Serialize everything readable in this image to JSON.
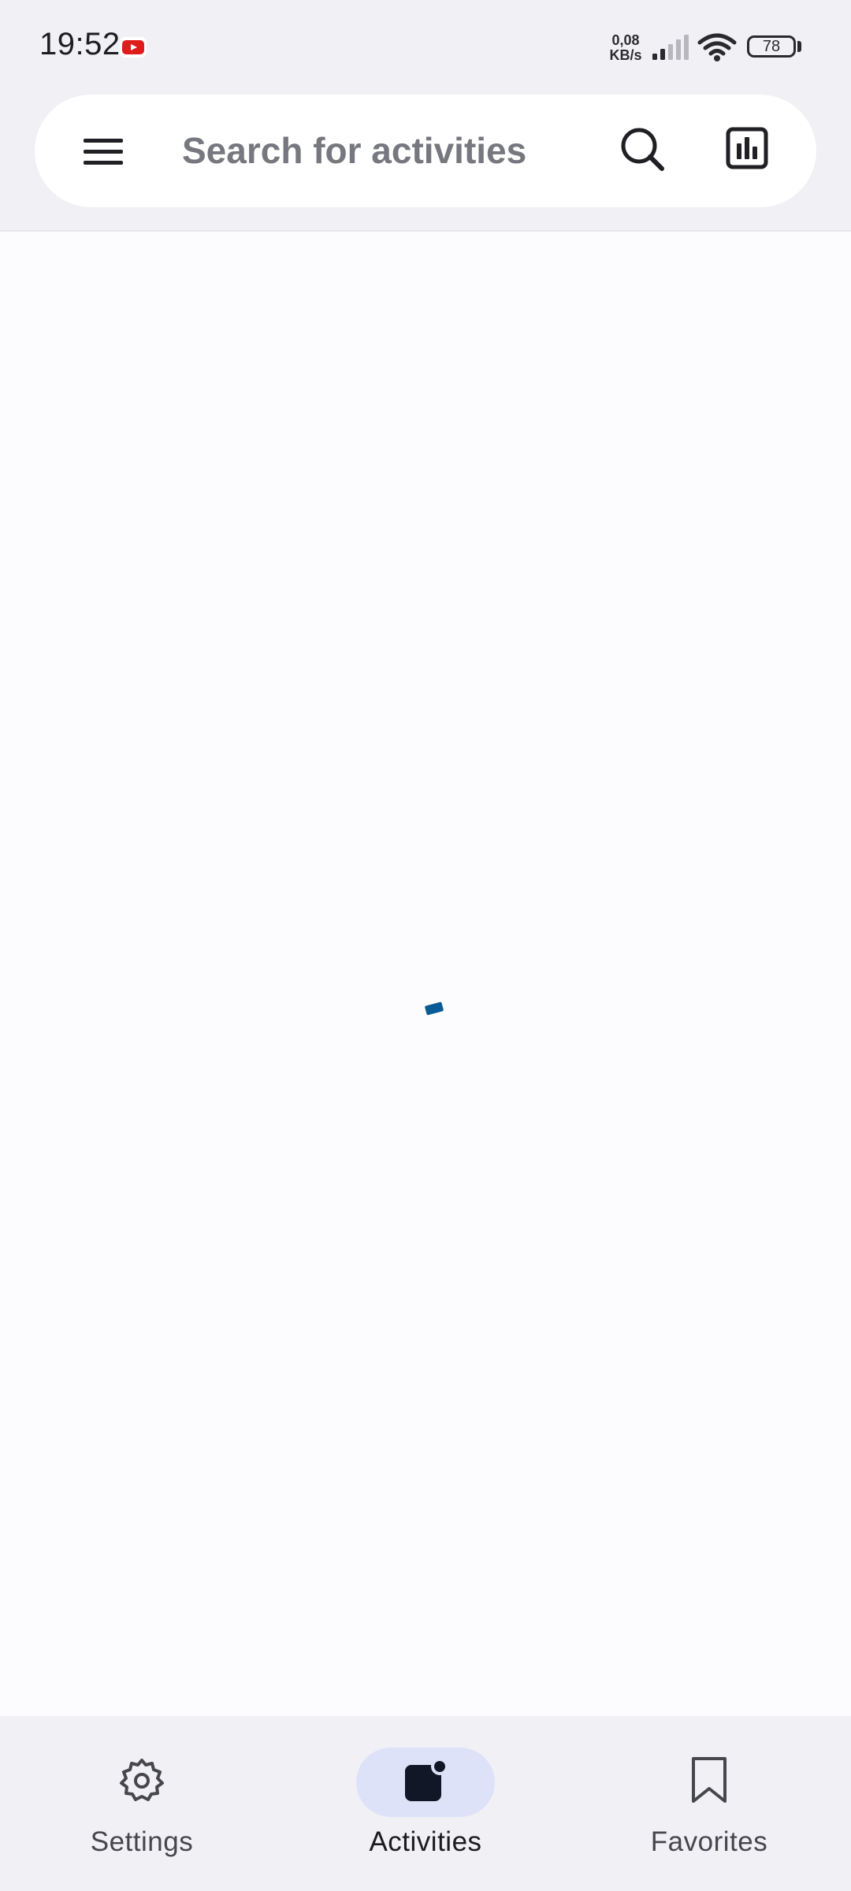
{
  "status_bar": {
    "time": "19:52",
    "net_speed_value": "0,08",
    "net_speed_unit": "KB/s",
    "battery_level": "78",
    "notification_icon": "youtube-icon",
    "icons": [
      "signal-icon",
      "wifi-icon",
      "battery-icon"
    ]
  },
  "search": {
    "placeholder": "Search for activities",
    "menu_icon": "hamburger-menu-icon",
    "search_icon": "search-icon",
    "stats_icon": "bar-chart-icon"
  },
  "content": {
    "state": "loading",
    "spinner_color": "#0a5a96"
  },
  "bottom_nav": {
    "items": [
      {
        "label": "Settings",
        "icon": "gear-icon",
        "active": false
      },
      {
        "label": "Activities",
        "icon": "activities-icon",
        "active": true
      },
      {
        "label": "Favorites",
        "icon": "bookmark-icon",
        "active": false
      }
    ],
    "active_pill_color": "#dde2f8"
  }
}
